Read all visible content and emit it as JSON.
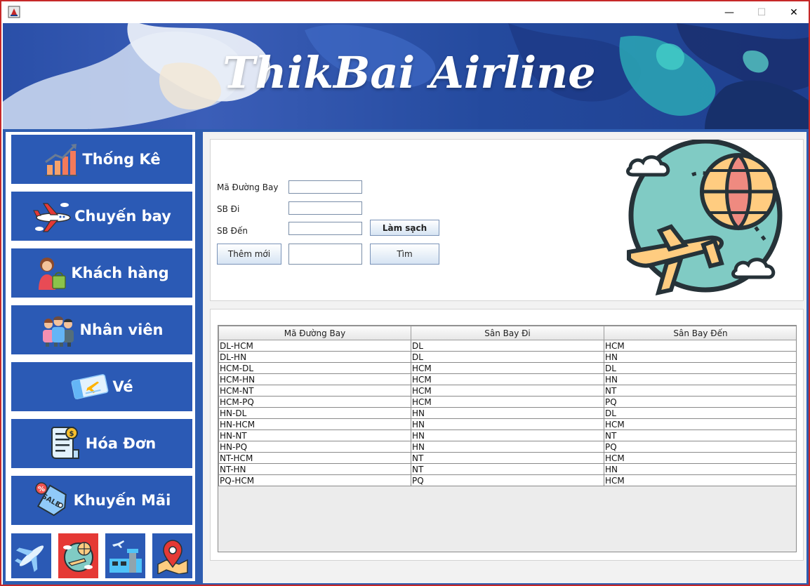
{
  "window": {
    "minimize_glyph": "—",
    "maximize_glyph": "☐",
    "close_glyph": "✕"
  },
  "banner": {
    "title": "ThikBai Airline"
  },
  "sidebar": {
    "items": [
      {
        "label": "Thống Kê",
        "icon": "bar-chart-icon"
      },
      {
        "label": "Chuyến bay",
        "icon": "airplane-icon"
      },
      {
        "label": "Khách hàng",
        "icon": "customer-shopping-icon"
      },
      {
        "label": "Nhân viên",
        "icon": "staff-group-icon"
      },
      {
        "label": "Vé",
        "icon": "ticket-icon"
      },
      {
        "label": "Hóa Đơn",
        "icon": "invoice-icon"
      },
      {
        "label": "Khuyến Mãi",
        "icon": "sale-tag-icon"
      }
    ],
    "tiles": [
      "plane-tile-icon",
      "world-route-tile-icon",
      "airport-tile-icon",
      "map-pin-tile-icon"
    ]
  },
  "form": {
    "route_code_label": "Mã Đường Bay",
    "route_code_value": "",
    "from_label": "SB Đi",
    "from_value": "",
    "to_label": "SB Đến",
    "to_value": "",
    "search_value": "",
    "clear_label": "Làm sạch",
    "add_label": "Thêm mới",
    "search_label": "Tìm",
    "illustration": "globe-flight-icon"
  },
  "table": {
    "columns": [
      "Mã Đường Bay",
      "Sân Bay Đi",
      "Sân Bay Đến"
    ],
    "rows": [
      [
        "DL-HCM",
        "DL",
        "HCM"
      ],
      [
        "DL-HN",
        "DL",
        "HN"
      ],
      [
        "HCM-DL",
        "HCM",
        "DL"
      ],
      [
        "HCM-HN",
        "HCM",
        "HN"
      ],
      [
        "HCM-NT",
        "HCM",
        "NT"
      ],
      [
        "HCM-PQ",
        "HCM",
        "PQ"
      ],
      [
        "HN-DL",
        "HN",
        "DL"
      ],
      [
        "HN-HCM",
        "HN",
        "HCM"
      ],
      [
        "HN-NT",
        "HN",
        "NT"
      ],
      [
        "HN-PQ",
        "HN",
        "PQ"
      ],
      [
        "NT-HCM",
        "NT",
        "HCM"
      ],
      [
        "NT-HN",
        "NT",
        "HN"
      ],
      [
        "PQ-HCM",
        "PQ",
        "HCM"
      ]
    ]
  },
  "colors": {
    "sidebar_button": "#2b5ab5",
    "frame": "#2e5db0",
    "window_border": "#c62828"
  }
}
